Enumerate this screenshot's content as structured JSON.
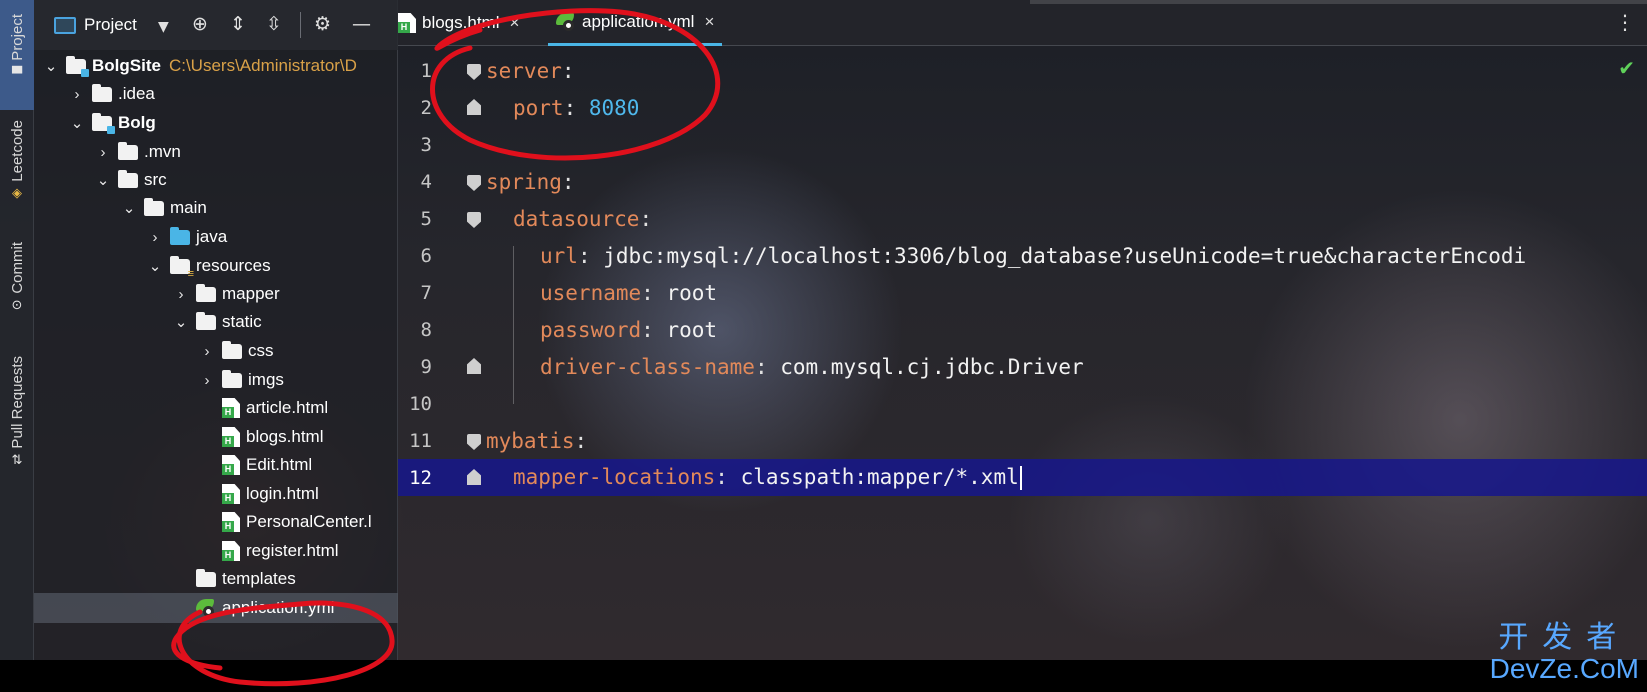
{
  "tool_window_tabs": [
    {
      "label": "Project",
      "icon": "folder-icon"
    },
    {
      "label": "Leetcode",
      "icon": "leetcode-icon"
    },
    {
      "label": "Commit",
      "icon": "commit-icon"
    },
    {
      "label": "Pull Requests",
      "icon": "pull-request-icon"
    }
  ],
  "project_panel": {
    "title": "Project",
    "tree": [
      {
        "label": "BolgSite",
        "path": "C:\\Users\\Administrator\\D",
        "type": "module"
      },
      {
        "label": ".idea",
        "type": "folder"
      },
      {
        "label": "Bolg",
        "type": "module"
      },
      {
        "label": ".mvn",
        "type": "folder"
      },
      {
        "label": "src",
        "type": "folder"
      },
      {
        "label": "main",
        "type": "folder"
      },
      {
        "label": "java",
        "type": "source-folder"
      },
      {
        "label": "resources",
        "type": "resources-folder"
      },
      {
        "label": "mapper",
        "type": "folder"
      },
      {
        "label": "static",
        "type": "folder"
      },
      {
        "label": "css",
        "type": "folder"
      },
      {
        "label": "imgs",
        "type": "folder"
      },
      {
        "label": "article.html",
        "type": "html"
      },
      {
        "label": "blogs.html",
        "type": "html"
      },
      {
        "label": "Edit.html",
        "type": "html"
      },
      {
        "label": "login.html",
        "type": "html"
      },
      {
        "label": "PersonalCenter.l",
        "type": "html"
      },
      {
        "label": "register.html",
        "type": "html"
      },
      {
        "label": "templates",
        "type": "folder"
      },
      {
        "label": "application.yml",
        "type": "yml",
        "selected": true
      }
    ]
  },
  "editor": {
    "tabs": [
      {
        "label": "blogs.html",
        "close": "×",
        "active": false
      },
      {
        "label": "application.yml",
        "close": "×",
        "active": true
      }
    ],
    "lines": [
      {
        "n": "1",
        "key": "server",
        "sep": ":",
        "value": ""
      },
      {
        "n": "2",
        "key": "port",
        "sep": ": ",
        "value": "8080"
      },
      {
        "n": "3",
        "key": "",
        "sep": "",
        "value": ""
      },
      {
        "n": "4",
        "key": "spring",
        "sep": ":",
        "value": ""
      },
      {
        "n": "5",
        "key": "datasource",
        "sep": ":",
        "value": ""
      },
      {
        "n": "6",
        "key": "url",
        "sep": ": ",
        "value": "jdbc:mysql://localhost:3306/blog_database?useUnicode=true&characterEncodi"
      },
      {
        "n": "7",
        "key": "username",
        "sep": ": ",
        "value": "root"
      },
      {
        "n": "8",
        "key": "password",
        "sep": ": ",
        "value": "root"
      },
      {
        "n": "9",
        "key": "driver-class-name",
        "sep": ": ",
        "value": "com.mysql.cj.jdbc.Driver"
      },
      {
        "n": "10",
        "key": "",
        "sep": "",
        "value": ""
      },
      {
        "n": "11",
        "key": "mybatis",
        "sep": ":",
        "value": ""
      },
      {
        "n": "12",
        "key": "mapper-locations",
        "sep": ": ",
        "value": "classpath:mapper/*.xml"
      }
    ]
  },
  "watermark": {
    "line1": "开发者",
    "line2": "DevZe.CoM"
  },
  "colors": {
    "yaml_key": "#e2895a",
    "yaml_number": "#4fb8ec",
    "current_line": "#16168c",
    "annotation": "#e0101c",
    "watermark": "#58a8ff"
  }
}
